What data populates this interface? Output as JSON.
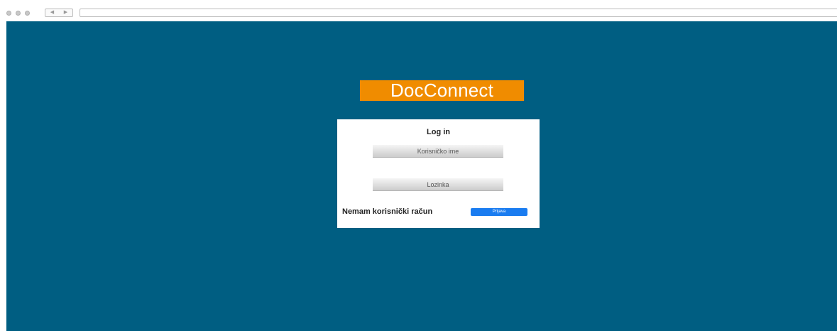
{
  "browser": {
    "back_glyph": "◀",
    "forward_glyph": "▶",
    "icons": {
      "back": "back-arrow-icon",
      "forward": "forward-arrow-icon"
    }
  },
  "colors": {
    "background": "#005e82",
    "logo_background": "#f08c00",
    "button": "#1a7cf0",
    "card": "#ffffff"
  },
  "logo": {
    "text": "DocConnect"
  },
  "login": {
    "title": "Log in",
    "username_placeholder": "Korisničko ime",
    "password_placeholder": "Lozinka",
    "no_account_text": "Nemam korisnički račun",
    "submit_label": "Prijava"
  }
}
